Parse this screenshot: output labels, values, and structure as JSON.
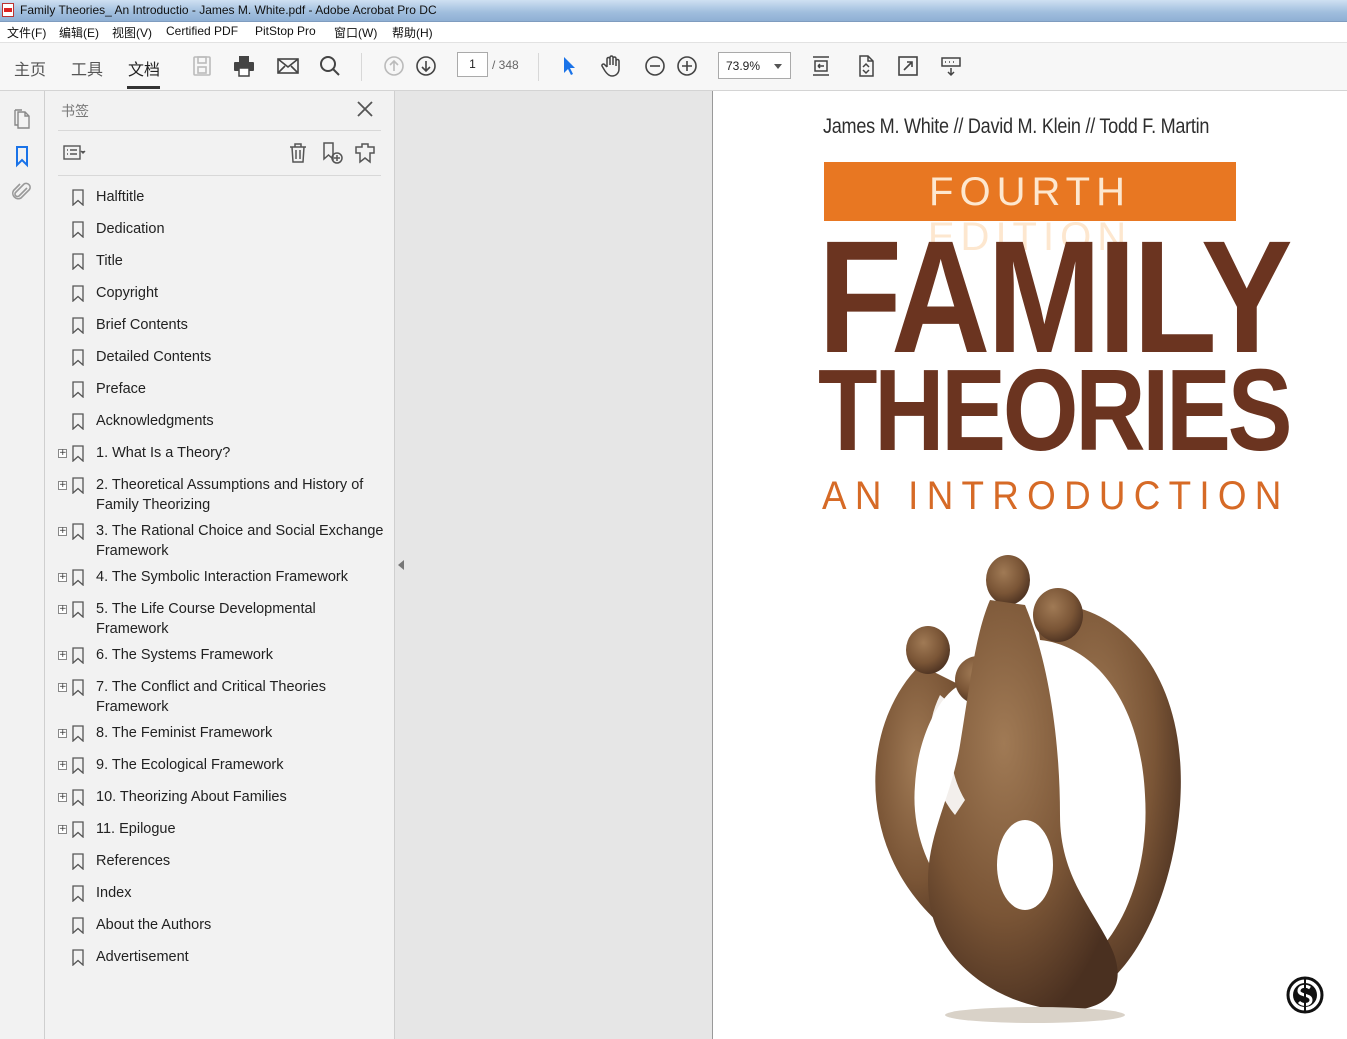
{
  "window": {
    "title": "Family Theories_ An Introductio - James M. White.pdf - Adobe Acrobat Pro DC"
  },
  "menu": [
    {
      "label": "文件(F)"
    },
    {
      "label": "编辑(E)"
    },
    {
      "label": "视图(V)"
    },
    {
      "label": "Certified PDF"
    },
    {
      "label": "PitStop Pro"
    },
    {
      "label": "窗口(W)"
    },
    {
      "label": "帮助(H)"
    }
  ],
  "tabs": [
    {
      "label": "主页"
    },
    {
      "label": "工具"
    },
    {
      "label": "文档",
      "active": true
    }
  ],
  "toolbar": {
    "current_page": "1",
    "total_pages": "/ 348",
    "zoom": "73.9%"
  },
  "panel": {
    "title": "书签",
    "bookmarks": [
      {
        "label": "Halftitle",
        "expandable": false
      },
      {
        "label": "Dedication",
        "expandable": false
      },
      {
        "label": "Title",
        "expandable": false
      },
      {
        "label": "Copyright",
        "expandable": false
      },
      {
        "label": "Brief Contents",
        "expandable": false
      },
      {
        "label": "Detailed Contents",
        "expandable": false
      },
      {
        "label": "Preface",
        "expandable": false
      },
      {
        "label": "Acknowledgments",
        "expandable": false
      },
      {
        "label": "1. What Is a Theory?",
        "expandable": true
      },
      {
        "label": "2. Theoretical Assumptions and History of Family Theorizing",
        "expandable": true
      },
      {
        "label": "3. The Rational Choice and Social Exchange Framework",
        "expandable": true
      },
      {
        "label": "4. The Symbolic Interaction Framework",
        "expandable": true
      },
      {
        "label": "5. The Life Course Developmental Framework",
        "expandable": true
      },
      {
        "label": "6. The Systems Framework",
        "expandable": true
      },
      {
        "label": "7. The Conflict and Critical Theories Framework",
        "expandable": true
      },
      {
        "label": "8. The Feminist Framework",
        "expandable": true
      },
      {
        "label": "9. The Ecological Framework",
        "expandable": true
      },
      {
        "label": "10. Theorizing About Families",
        "expandable": true
      },
      {
        "label": "11. Epilogue",
        "expandable": true
      },
      {
        "label": "References",
        "expandable": false
      },
      {
        "label": "Index",
        "expandable": false
      },
      {
        "label": "About the Authors",
        "expandable": false
      },
      {
        "label": "Advertisement",
        "expandable": false
      }
    ]
  },
  "cover": {
    "authors": "James M. White  //  David M. Klein  //  Todd F. Martin",
    "edition": "FOURTH EDITION",
    "title_line1": "FAMILY",
    "title_line2": "THEORIES",
    "subtitle": "AN INTRODUCTION",
    "colors": {
      "edition_bar": "#e87722",
      "title": "#6b3420",
      "subtitle": "#d66a26"
    }
  }
}
